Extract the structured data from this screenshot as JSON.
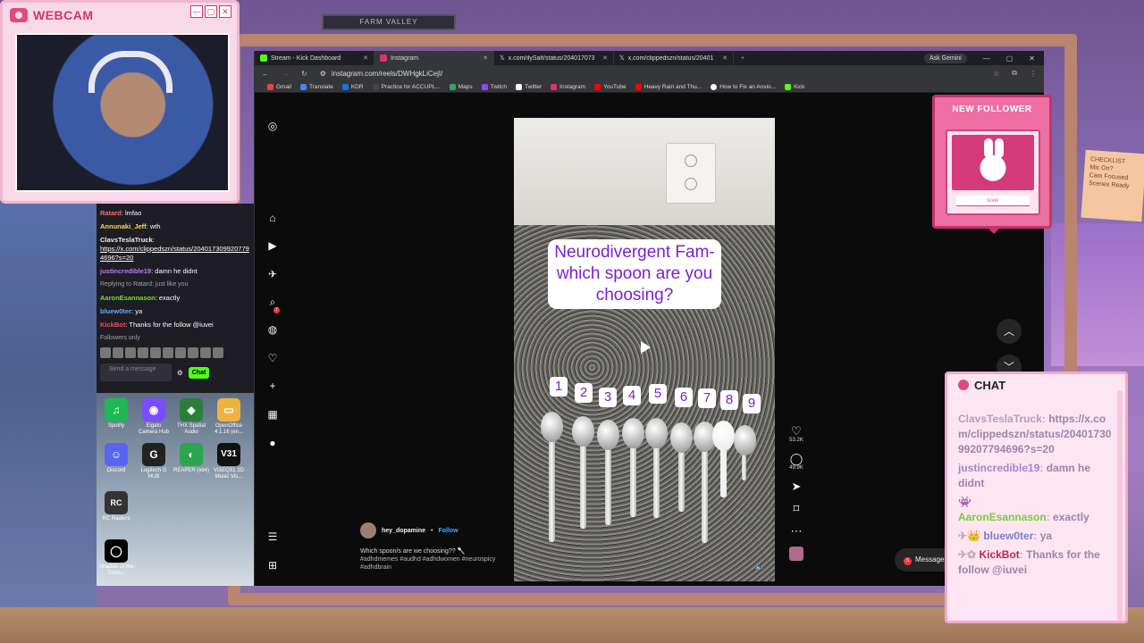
{
  "webcam": {
    "title": "WEBCAM",
    "min": "—",
    "max": "▢",
    "close": "✕"
  },
  "background": {
    "sign": "FARM VALLEY",
    "note": "CHECKLIST\nMic On?\nCam Focused\nScenes Ready"
  },
  "left_chat": {
    "messages": [
      {
        "user": "Ratard",
        "text": "lmfao",
        "color": "#ff6a6a"
      },
      {
        "user": "Annunaki_Jeff",
        "text": "wth",
        "color": "#ffd56a"
      },
      {
        "user": "ClavsTeslaTruck",
        "text": "",
        "color": "#f0f0f0"
      },
      {
        "user": "",
        "text": "https://x.com/clippedszn/status/2040173099207794696?s=20",
        "color": "#fff",
        "link": true
      },
      {
        "user": "justincredible19",
        "text": "damn he didnt",
        "color": "#c27bff"
      },
      {
        "user": "",
        "text": "Replying to Ratard: just like you",
        "color": "#a0a0a8"
      },
      {
        "user": "AaronEsannason",
        "text": "exactly",
        "color": "#7bdb3a"
      },
      {
        "user": "bluew0ter",
        "text": "ya",
        "color": "#6aa8ff"
      },
      {
        "user": "KickBot",
        "text": "Thanks for the follow @iuvei",
        "color": "#ff4a4a"
      }
    ],
    "followers_only": "Followers only",
    "send_placeholder": "Send a message",
    "chat_button": "Chat"
  },
  "desktop_icons": [
    {
      "label": "Spotify",
      "glyph": "♫",
      "color": "#1db954"
    },
    {
      "label": "Elgato Camera Hub",
      "glyph": "◉",
      "color": "#7c4dff"
    },
    {
      "label": "THX Spatial Audio",
      "glyph": "◈",
      "color": "#2d7d3a"
    },
    {
      "label": "OpenOffice 4.1.16 (en...",
      "glyph": "▭",
      "color": "#f0b340"
    },
    {
      "label": "Discord",
      "glyph": "☺",
      "color": "#5865f2"
    },
    {
      "label": "Logitech G HUB",
      "glyph": "G",
      "color": "#222"
    },
    {
      "label": "REAPER (x64)",
      "glyph": "◐",
      "color": "#2da44e"
    },
    {
      "label": "ViSEQ31 3D Music Vis...",
      "glyph": "V31",
      "color": "#111"
    },
    {
      "label": "RC Raiders",
      "glyph": "RC",
      "color": "#333"
    },
    {
      "label": "Shadow of the Tomb...",
      "glyph": "◯",
      "color": "#000"
    }
  ],
  "browser": {
    "tabs": [
      {
        "label": "Stream - Kick Dashboard",
        "color": "#53fc18"
      },
      {
        "label": "Instagram",
        "color": "#e1306c"
      },
      {
        "label": "x.com/ilySalt/status/204017073...",
        "color": "#ffffff"
      },
      {
        "label": "x.com/clippedszn/status/20401...",
        "color": "#ffffff"
      }
    ],
    "new_tab": "+",
    "gemini": "Ask Gemini",
    "url": "instagram.com/reels/DWHgkLiCejI/",
    "bookmarks": [
      {
        "label": "Gmail",
        "color": "#ea4335"
      },
      {
        "label": "Translate",
        "color": "#4285f4"
      },
      {
        "label": "KDR",
        "color": "#1a73e8"
      },
      {
        "label": "Practice for ACCUPL...",
        "color": "#444"
      },
      {
        "label": "Maps",
        "color": "#34a853"
      },
      {
        "label": "Twitch",
        "color": "#9146ff"
      },
      {
        "label": "Twitter",
        "color": "#ffffff"
      },
      {
        "label": "Instagram",
        "color": "#e1306c"
      },
      {
        "label": "YouTube",
        "color": "#ff0000"
      },
      {
        "label": "Heavy Rain and Thu...",
        "color": "#ff0000"
      },
      {
        "label": "How to Fix an Anxio...",
        "color": "#ffffff"
      },
      {
        "label": "Kick",
        "color": "#53fc18"
      }
    ]
  },
  "reel": {
    "text": "Neurodivergent Fam- which spoon are you choosing?",
    "numbers": [
      "1",
      "2",
      "3",
      "4",
      "5",
      "6",
      "7",
      "8",
      "9"
    ],
    "likes": "53.2K",
    "comments": "49.9K",
    "username": "hey_dopamine",
    "follow": "Follow",
    "caption": "Which spoon/s are we choosing?? 🥄",
    "tags": "#adhdmemes #audhd #adhdwomen #neurospicy #adhdbrain",
    "messages_label": "Messages",
    "messages_count": "5",
    "notif_count": "7"
  },
  "follower": {
    "title": "NEW FOLLOWER",
    "name": "iuvei"
  },
  "chat_overlay": {
    "title": "CHAT",
    "messages": [
      {
        "user": "ClavsTeslaTruck",
        "text": "https://x.com/clippedszn/status/2040173099207794696?s=20"
      },
      {
        "user": "justincredible19",
        "text": "damn he didnt"
      },
      {
        "user": "AaronEsannason",
        "text": "exactly"
      },
      {
        "user": "bluew0ter",
        "text": "ya"
      },
      {
        "user": "KickBot",
        "text": "Thanks for the follow @iuvei"
      }
    ]
  }
}
